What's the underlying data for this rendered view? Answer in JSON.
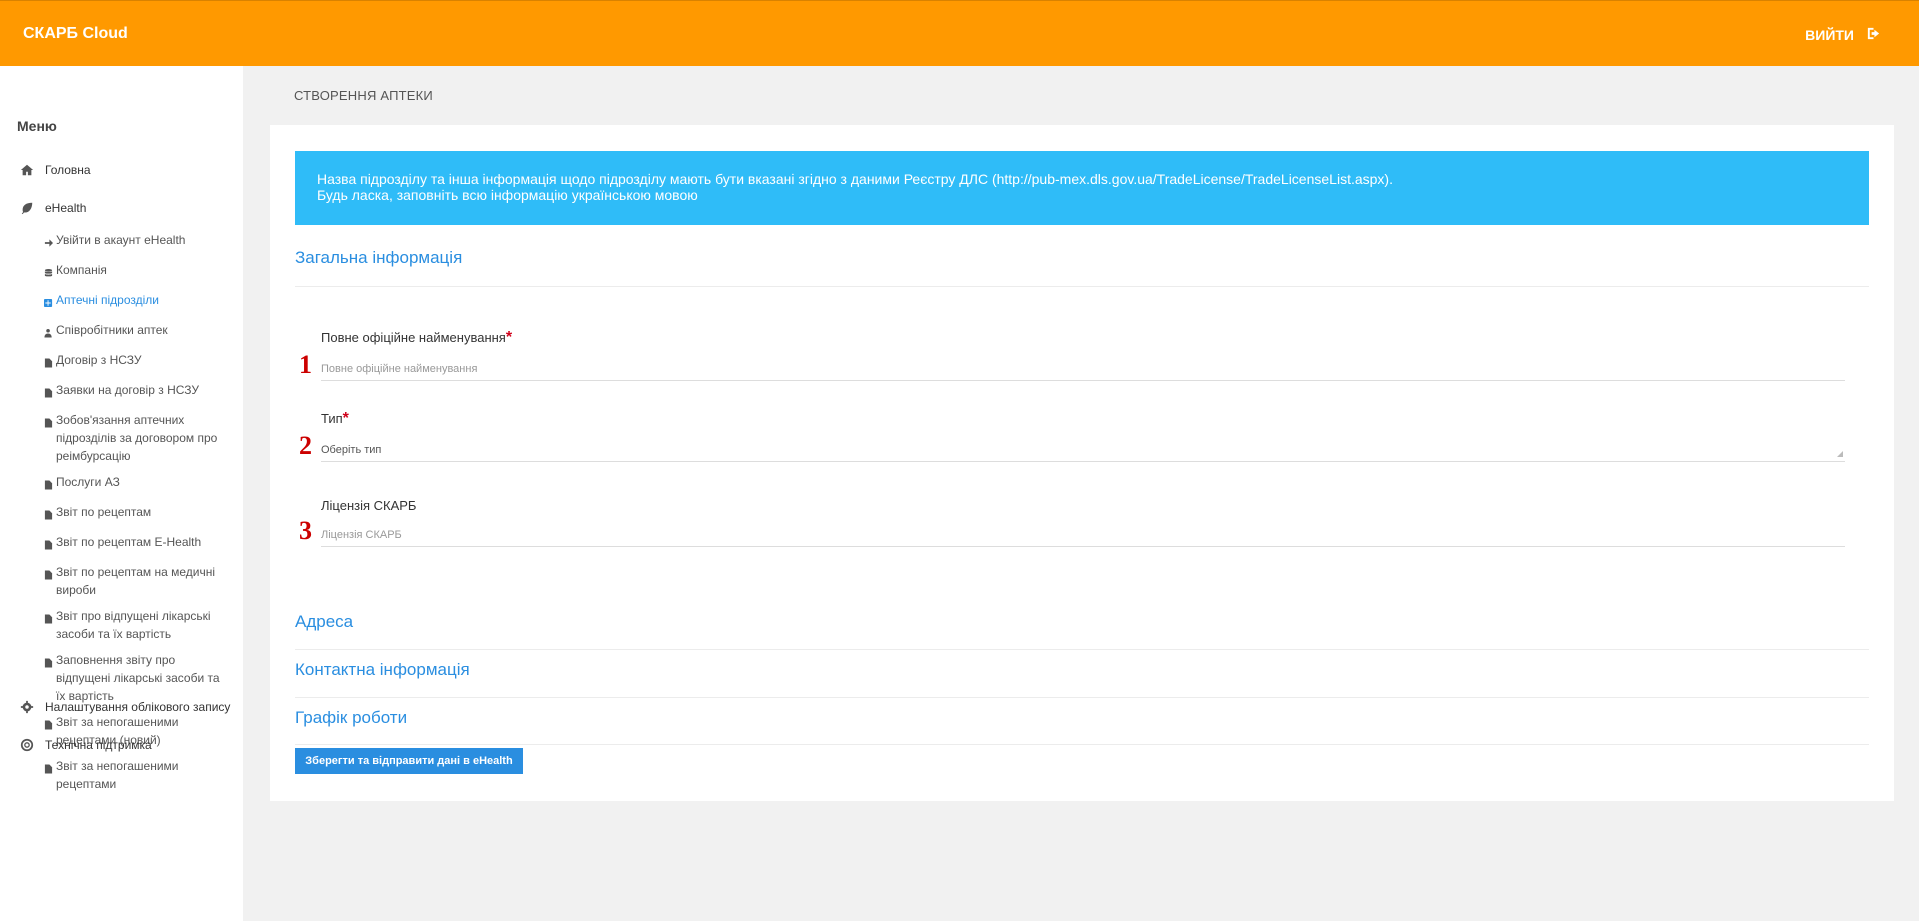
{
  "app": {
    "brand": "СКАРБ Cloud",
    "logout_label": "вийти"
  },
  "sidebar": {
    "title": "Меню",
    "home": "Головна",
    "ehealth": "eHealth",
    "items": [
      {
        "label": "Увійти в акаунт eHealth",
        "icon": "sign-in-icon"
      },
      {
        "label": "Компанія",
        "icon": "database-icon"
      },
      {
        "label": "Аптечні підрозділи",
        "icon": "plus-square-icon",
        "active": true
      },
      {
        "label": "Співробітники аптек",
        "icon": "user-md-icon"
      },
      {
        "label": "Договір з НСЗУ",
        "icon": "file-icon"
      },
      {
        "label": "Заявки на договір з НСЗУ",
        "icon": "file-icon"
      },
      {
        "label": "Зобов'язання аптечних підрозділів за договором про реімбурсацію",
        "icon": "file-icon"
      },
      {
        "label": "Послуги АЗ",
        "icon": "file-icon"
      },
      {
        "label": "Звіт по рецептам",
        "icon": "file-icon"
      },
      {
        "label": "Звіт по рецептам E-Health",
        "icon": "file-icon"
      },
      {
        "label": "Звіт по рецептам на медичні вироби",
        "icon": "file-icon"
      },
      {
        "label": "Звіт про відпущені лікарські засоби та їх вартість",
        "icon": "file-icon"
      },
      {
        "label": "Заповнення звіту про відпущені лікарські засоби та їх вартість",
        "icon": "file-icon"
      },
      {
        "label": "Звіт за непогашеними рецептами (новий)",
        "icon": "file-icon"
      },
      {
        "label": "Звіт за непогашеними рецептами",
        "icon": "file-icon"
      }
    ],
    "settings": "Налаштування облікового запису",
    "support": "Технічна підтримка"
  },
  "page": {
    "breadcrumb": "СТВОРЕННЯ АПТЕКИ",
    "info_line1": "Назва підрозділу та інша інформація щодо підрозділу мають бути вказані згідно з даними Реєстру ДЛС (http://pub-mex.dls.gov.ua/TradeLicense/TradeLicenseList.aspx).",
    "info_line2": "Будь ласка, заповніть всю інформацію українською мовою",
    "section_general": "Загальна інформація",
    "field_name_label": "Повне офіційне найменування",
    "field_name_placeholder": "Повне офіційне найменування",
    "field_type_label": "Тип",
    "field_type_value": "Оберіть тип",
    "field_license_label": "Ліцензія СКАРБ",
    "field_license_placeholder": "Ліцензія СКАРБ",
    "required_mark": "*",
    "markers": [
      "1",
      "2",
      "3"
    ],
    "section_address": "Адреса",
    "section_contacts": "Контактна інформація",
    "section_schedule": "Графік роботи",
    "save_button": "Зберегти та відправити дані в eHealth"
  },
  "colors": {
    "header": "#ff9900",
    "accent": "#2a8ee0",
    "info_banner": "#2fbcf8",
    "marker": "#cc0000"
  }
}
